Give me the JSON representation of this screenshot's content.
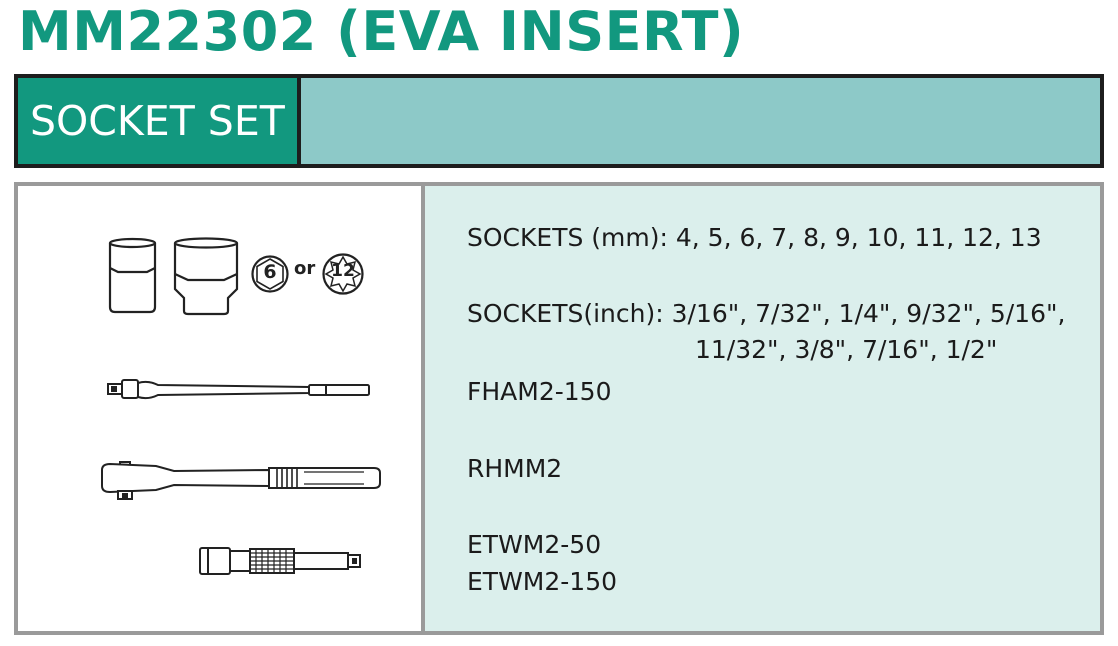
{
  "title": "MM22302 (EVA INSERT)",
  "header": {
    "label": "SOCKET SET"
  },
  "socket_icons": {
    "hex6": "6",
    "or": "or",
    "hex12": "12"
  },
  "specs": {
    "sockets_mm_label": "SOCKETS (mm):",
    "sockets_mm_values": "4, 5, 6, 7, 8, 9, 10, 11, 12, 13",
    "sockets_inch_label": "SOCKETS(inch):",
    "sockets_inch_values_1": "3/16\", 7/32\", 1/4\", 9/32\", 5/16\",",
    "sockets_inch_values_2": "11/32\", 3/8\", 7/16\", 1/2\"",
    "flex_handle": "FHAM2-150",
    "ratchet": "RHMM2",
    "extension_1": "ETWM2-50",
    "extension_2": "ETWM2-150"
  },
  "colors": {
    "title": "#12987f",
    "header_label_bg": "#12987f",
    "header_fill_bg": "#8dc9c8",
    "panel_right_bg": "#dbefec",
    "panel_border": "#9a9a9a"
  }
}
